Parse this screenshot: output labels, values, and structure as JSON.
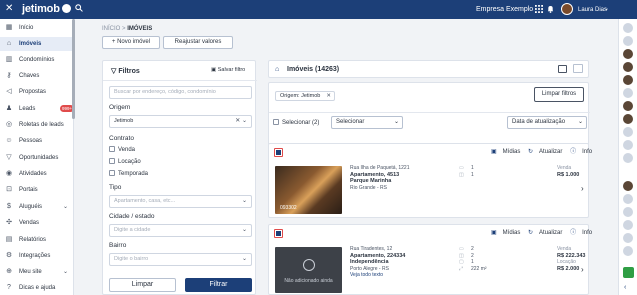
{
  "topbar": {
    "brand": "jetimob",
    "company": "Empresa Exemplo",
    "user": "Laura Dias"
  },
  "sidebar": {
    "items": [
      {
        "label": "Início",
        "icon": "grid-icon"
      },
      {
        "label": "Imóveis",
        "icon": "home-icon",
        "active": true
      },
      {
        "label": "Condomínios",
        "icon": "building-icon"
      },
      {
        "label": "Chaves",
        "icon": "key-icon"
      },
      {
        "label": "Propostas",
        "icon": "megaphone-icon"
      },
      {
        "label": "Leads",
        "icon": "users-icon",
        "badge": "999+"
      },
      {
        "label": "Roletas de leads",
        "icon": "roulette-icon"
      },
      {
        "label": "Pessoas",
        "icon": "person-icon"
      },
      {
        "label": "Oportunidades",
        "icon": "funnel-icon"
      },
      {
        "label": "Atividades",
        "icon": "check-circle-icon"
      },
      {
        "label": "Portais",
        "icon": "portal-icon"
      },
      {
        "label": "Aluguéis",
        "icon": "dollar-icon",
        "caret": true
      },
      {
        "label": "Vendas",
        "icon": "handshake-icon"
      },
      {
        "label": "Relatórios",
        "icon": "report-icon"
      },
      {
        "label": "Integrações",
        "icon": "plug-icon"
      },
      {
        "label": "Meu site",
        "icon": "globe-icon",
        "caret": true
      },
      {
        "label": "Dicas e ajuda",
        "icon": "help-icon"
      }
    ]
  },
  "breadcrumb": {
    "root": "INÍCIO",
    "sep": ">",
    "current": "IMÓVEIS"
  },
  "actions": {
    "new": "+ Novo imóvel",
    "adjust": "Reajustar valores"
  },
  "filters": {
    "title": "Filtros",
    "save": "Salvar filtro",
    "search_placeholder": "Buscar por endereço, código, condomínio",
    "origem_label": "Origem",
    "origem_value": "Jetimob",
    "contrato_label": "Contrato",
    "contrato_options": [
      "Venda",
      "Locação",
      "Temporada"
    ],
    "tipo_label": "Tipo",
    "tipo_placeholder": "Apartamento, casa, etc...",
    "cidade_label": "Cidade / estado",
    "cidade_placeholder": "Digite a cidade",
    "bairro_label": "Bairro",
    "bairro_placeholder": "Digite o bairro",
    "clear": "Limpar",
    "apply": "Filtrar"
  },
  "list": {
    "title": "Imóveis (14263)",
    "chip": "Origem: Jetimob",
    "clear_filters": "Limpar filtros",
    "select_all": "Selecionar (2)",
    "select_dd": "Selecionar",
    "sort_dd": "Data de atualização"
  },
  "cards": [
    {
      "actions": [
        "Mídias",
        "Atualizar",
        "Info"
      ],
      "code": "093302",
      "address": "Rua Ilha de Paquetá, 1221",
      "title": "Apartamento, 4513",
      "district": "Parque Marinha",
      "city": "Rio Grande - RS",
      "stats": [
        "1",
        "1"
      ],
      "price_label": "Venda",
      "price": "R$ 1.000",
      "rent_label": "",
      "rent": "",
      "link": ""
    },
    {
      "actions": [
        "Mídias",
        "Atualizar",
        "Info"
      ],
      "code": "",
      "photo_text": "Não adicionado ainda",
      "address": "Rua Tiradentes, 12",
      "title": "Apartamento, 224334",
      "district": "Independência",
      "city": "Porto Alegre - RS",
      "link": "Veja todo texto",
      "stats": [
        "2",
        "2",
        "1",
        "222 m²"
      ],
      "price_label": "Venda",
      "price": "R$ 222.343",
      "rent_label": "Locação",
      "rent": "R$ 2.000"
    }
  ]
}
